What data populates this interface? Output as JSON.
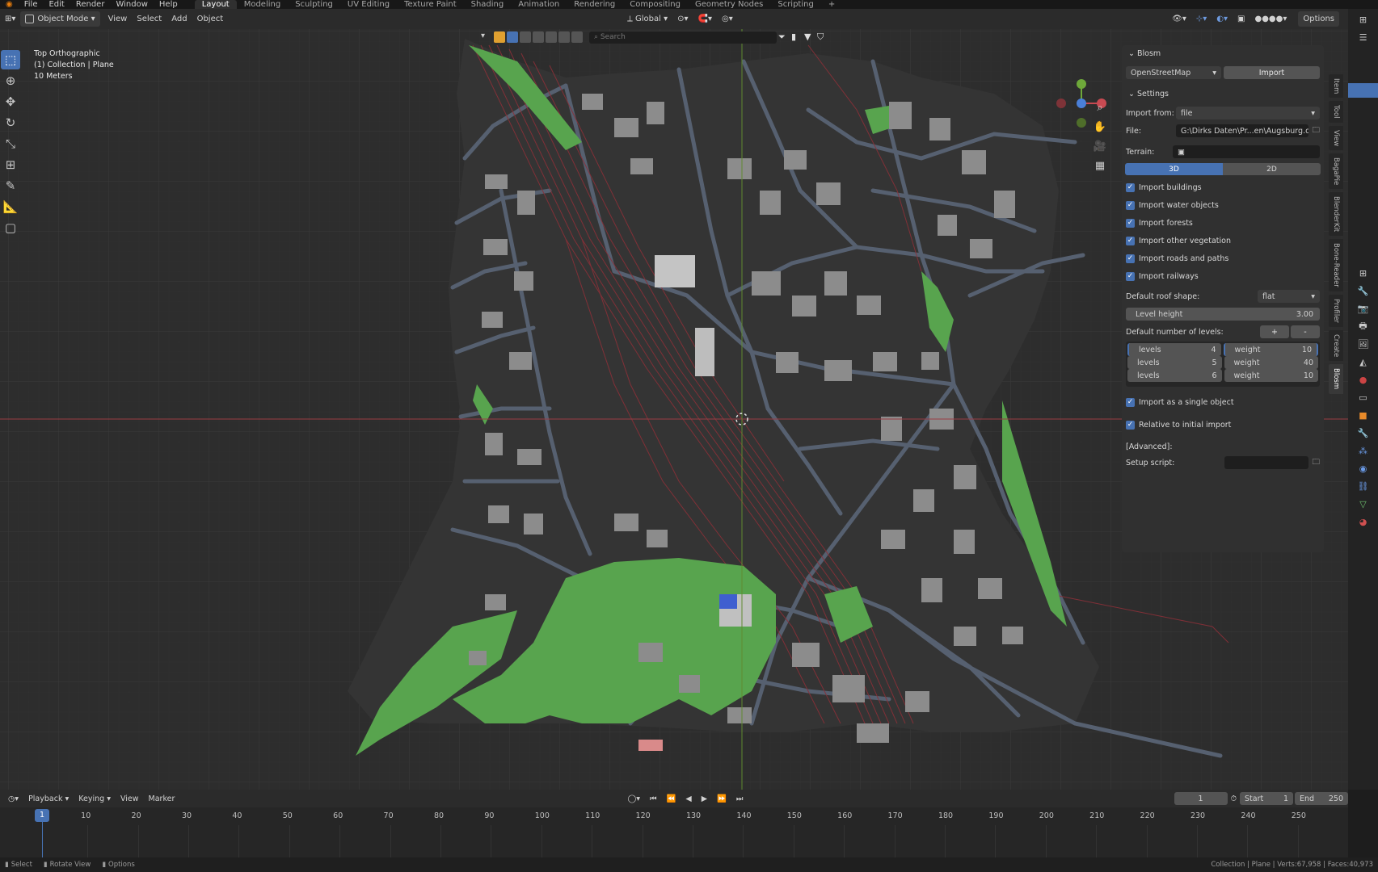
{
  "menu": {
    "items": [
      "File",
      "Edit",
      "Render",
      "Window",
      "Help"
    ],
    "workspaces": [
      "Layout",
      "Modeling",
      "Sculpting",
      "UV Editing",
      "Texture Paint",
      "Shading",
      "Animation",
      "Rendering",
      "Compositing",
      "Geometry Nodes",
      "Scripting"
    ],
    "add_tab": "+"
  },
  "header": {
    "mode": "Object Mode",
    "menus": [
      "View",
      "Select",
      "Add",
      "Object"
    ],
    "orientation": "Global",
    "options": "Options"
  },
  "viewport": {
    "view_name": "Top Orthographic",
    "collection": "(1) Collection | Plane",
    "scale": "10 Meters",
    "search_placeholder": "Search"
  },
  "blosm": {
    "panel_title": "Blosm",
    "source": "OpenStreetMap",
    "import_label": "Import",
    "settings_title": "Settings",
    "import_from_label": "Import from:",
    "import_from_value": "file",
    "file_label": "File:",
    "file_value": "G:\\Dirks Daten\\Pr...en\\Augsburg.osm",
    "terrain_label": "Terrain:",
    "mode_3d": "3D",
    "mode_2d": "2D",
    "checks": [
      "Import buildings",
      "Import water objects",
      "Import forests",
      "Import other vegetation",
      "Import roads and paths",
      "Import railways"
    ],
    "roof_label": "Default roof shape:",
    "roof_value": "flat",
    "level_height_label": "Level height",
    "level_height_value": "3.00",
    "num_levels_label": "Default number of levels:",
    "plus": "+",
    "minus": "-",
    "levels": [
      {
        "levels_label": "levels",
        "levels": "4",
        "weight_label": "weight",
        "weight": "10"
      },
      {
        "levels_label": "levels",
        "levels": "5",
        "weight_label": "weight",
        "weight": "40"
      },
      {
        "levels_label": "levels",
        "levels": "6",
        "weight_label": "weight",
        "weight": "10"
      }
    ],
    "single_object": "Import as a single object",
    "relative_import": "Relative to initial import",
    "advanced": "[Advanced]:",
    "setup_script": "Setup script:"
  },
  "ntabs": [
    "Item",
    "Tool",
    "View",
    "BagaPie",
    "BlenderKit",
    "Bone-Reader",
    "Profiler",
    "Create",
    "Blosm"
  ],
  "timeline": {
    "menus": [
      "Playback",
      "Keying",
      "View",
      "Marker"
    ],
    "current_frame": "1",
    "start_label": "Start",
    "start": "1",
    "end_label": "End",
    "end": "250",
    "ticks": [
      "10",
      "20",
      "30",
      "40",
      "50",
      "60",
      "70",
      "80",
      "90",
      "100",
      "110",
      "120",
      "130",
      "140",
      "150",
      "160",
      "170",
      "180",
      "190",
      "200",
      "210",
      "220",
      "230",
      "240",
      "250"
    ],
    "playhead": "1"
  },
  "status": {
    "select": "Select",
    "rotate": "Rotate View",
    "options": "Options",
    "stats": "Collection | Plane | Verts:67,958 | Faces:40,973"
  },
  "colors": {
    "accent": "#4772b3",
    "viewport": "#2d2d2d",
    "park": "#58a44e",
    "building": "#8c8c8c",
    "road": "#566070",
    "rail": "#8a3038"
  }
}
